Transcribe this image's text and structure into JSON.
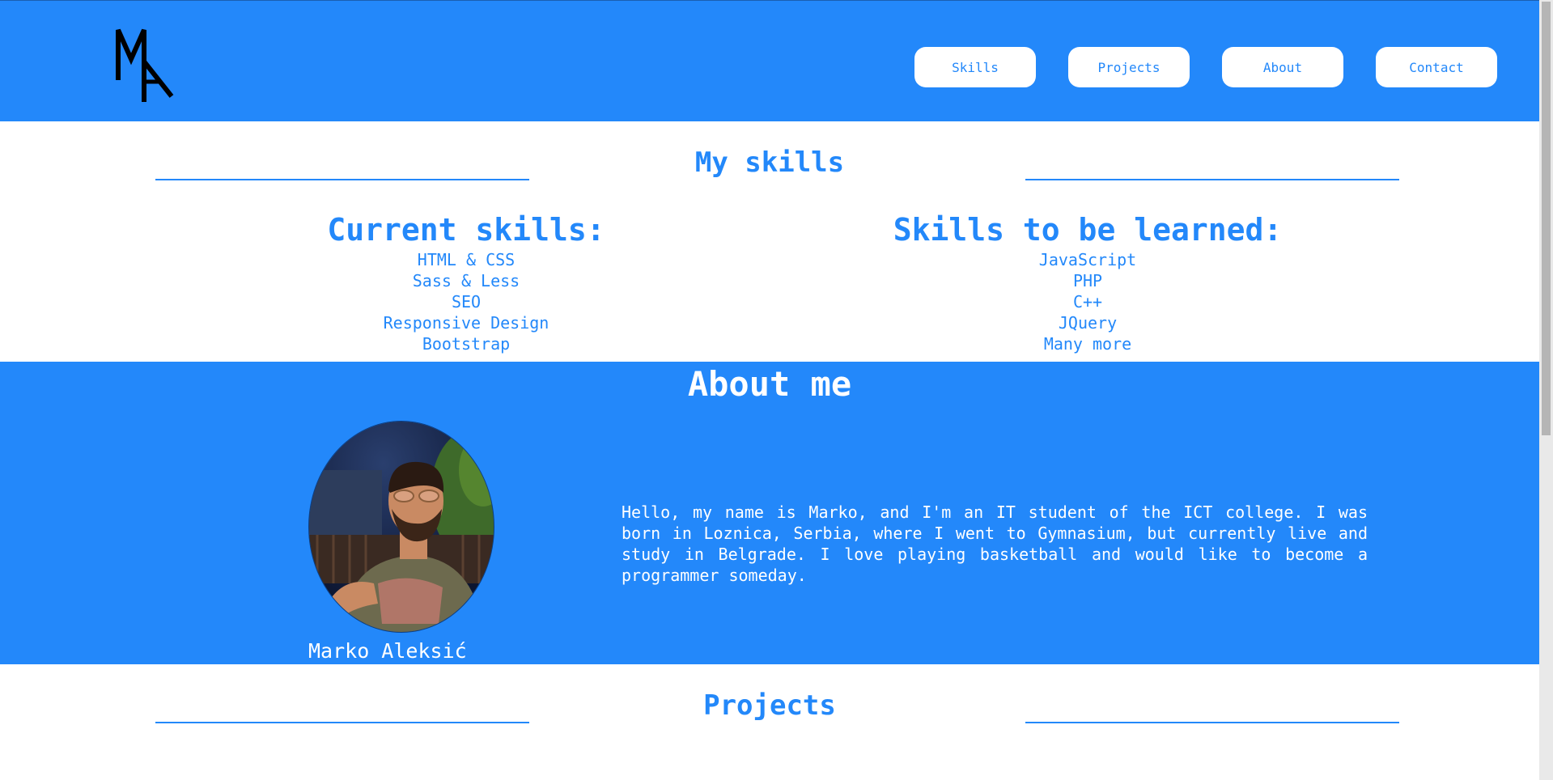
{
  "header": {
    "logo_text": "MA",
    "nav": [
      "Skills",
      "Projects",
      "About",
      "Contact"
    ]
  },
  "skills": {
    "title": "My skills",
    "current": {
      "title": "Current skills:",
      "items": [
        "HTML & CSS",
        "Sass & Less",
        "SEO",
        "Responsive Design",
        "Bootstrap"
      ]
    },
    "to_learn": {
      "title": "Skills to be learned:",
      "items": [
        "JavaScript",
        "PHP",
        "C++",
        "JQuery",
        "Many more"
      ]
    }
  },
  "about": {
    "title": "About me",
    "name": "Marko Aleksić",
    "bio": "Hello, my name is Marko, and I'm an IT student of the ICT college. I was born in Loznica, Serbia, where I went to Gymnasium, but currently live and study in Belgrade. I love playing basketball and would like to become a programmer someday."
  },
  "projects": {
    "title": "Projects"
  },
  "colors": {
    "accent": "#2388fa",
    "background": "#ffffff"
  }
}
